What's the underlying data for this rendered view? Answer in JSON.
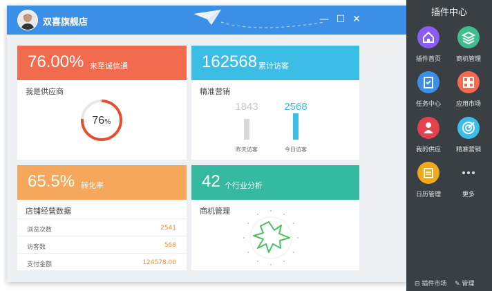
{
  "window": {
    "title": "双喜旗舰店",
    "controls": {
      "minimize": "—",
      "maximize": "☐",
      "close": "✕"
    }
  },
  "cards": {
    "integrity": {
      "value": "76.00%",
      "label": "来至诚信通",
      "subtitle": "我是供应商",
      "gauge_text": "76",
      "gauge_unit": "%",
      "gauge_percent": 76,
      "color": "#f26b4f"
    },
    "visitors": {
      "value": "162568",
      "label": "累计访客",
      "subtitle": "精准营销",
      "bars": [
        {
          "value": "1843",
          "label": "昨天访客",
          "numeric": 1843
        },
        {
          "value": "2568",
          "label": "今日访客",
          "numeric": 2568
        }
      ],
      "color": "#3cbde6"
    },
    "conversion": {
      "value": "65.5%",
      "label": "转化率",
      "subtitle": "店铺经营数据",
      "rows": [
        {
          "key": "浏览次数",
          "val": "2541"
        },
        {
          "key": "访客数",
          "val": "568"
        },
        {
          "key": "支付金额",
          "val": "124578.00"
        }
      ],
      "color": "#f6a75b"
    },
    "industry": {
      "value": "42",
      "label": "个行业分析",
      "subtitle": "商机管理",
      "color": "#35b9a0"
    }
  },
  "panel": {
    "title": "插件中心",
    "plugins": [
      {
        "label": "插件首页",
        "icon": "home-icon",
        "color": "#8b5cf6"
      },
      {
        "label": "商机管理",
        "icon": "layers-icon",
        "color": "#3fbf8f"
      },
      {
        "label": "任务中心",
        "icon": "clipboard-icon",
        "color": "#3b8fe6"
      },
      {
        "label": "应用市场",
        "icon": "grid-icon",
        "color": "#f26b4f"
      },
      {
        "label": "我的供应",
        "icon": "users-icon",
        "color": "#e4414d"
      },
      {
        "label": "精准营销",
        "icon": "target-icon",
        "color": "#3cbde6"
      },
      {
        "label": "日历管理",
        "icon": "calendar-icon",
        "color": "#f0a81b"
      },
      {
        "label": "更多",
        "icon": "more-icon",
        "color": "#3a3f44"
      }
    ],
    "footer": {
      "market": "插件市场",
      "manage": "管理"
    }
  }
}
